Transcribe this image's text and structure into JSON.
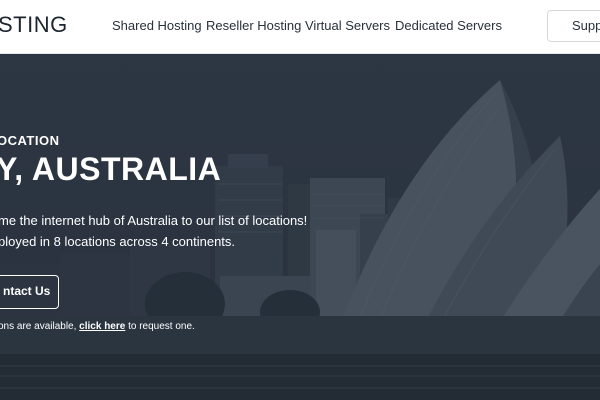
{
  "header": {
    "logo_text": "STING",
    "nav": [
      {
        "label": "Shared Hosting"
      },
      {
        "label": "Reseller Hosting"
      },
      {
        "label": "Virtual Servers"
      },
      {
        "label": "Dedicated Servers"
      }
    ],
    "support_label": "Suppo"
  },
  "hero": {
    "eyebrow": "OCATION",
    "headline": "Y, AUSTRALIA",
    "desc_line1": "me the internet hub of Australia to our list of locations!",
    "desc_line2": "ployed in 8 locations across 4 continents.",
    "contact_label": "ntact Us",
    "note_prefix": "ons are available, ",
    "note_link": "click here",
    "note_suffix": " to request one."
  },
  "colors": {
    "header_bg": "#ffffff",
    "hero_overlay": "#2b3440",
    "text_dark": "#27313c",
    "text_light": "#ffffff"
  }
}
